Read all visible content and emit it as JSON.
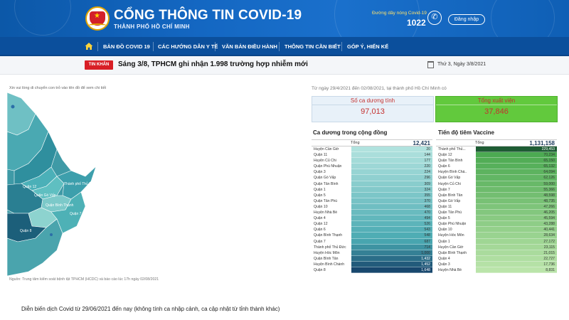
{
  "header": {
    "title": "CỔNG THÔNG TIN COVID-19",
    "subtitle": "THÀNH PHỐ HỒ CHÍ MINH",
    "hotline_label": "Đường dây nóng Covid-19",
    "hotline_number": "1022",
    "login_label": "Đăng nhập"
  },
  "nav": {
    "items": [
      "BẢN ĐỒ COVID 19",
      "CÁC HƯỚNG DẪN Y TẾ",
      "VĂN BẢN ĐIỀU HÀNH",
      "THÔNG TIN CẦN BIẾT",
      "GÓP Ý, HIẾN KẾ"
    ]
  },
  "ticker": {
    "badge": "TIN KHẨN",
    "text": "Sáng 3/8, TPHCM ghi nhận 1.998 trường hợp nhiễm mới",
    "date": "Thứ 3, Ngày 3/8/2021"
  },
  "map": {
    "hint": "Xin vui lòng di chuyển con trỏ vào tên đồ để xem chi tiết",
    "source": "Nguồn: Trung tâm kiểm soát bệnh tật TPHCM (HCDC) và báo cáo lúc 17h ngày 02/08/2021",
    "labels": [
      "Quận 12",
      "Quận Gò Vấp",
      "Thành phố Thủ Đức",
      "Quận Bình Thạnh",
      "Quận 7",
      "Quận 8"
    ]
  },
  "summary": {
    "range": "Từ ngày 29/4/2021 đến 02/08/2021, tại thành phố Hồ Chí Minh có",
    "positive_label": "Số ca dương tính",
    "positive_value": "97,013",
    "discharged_label": "Tổng xuất viện",
    "discharged_value": "37,846"
  },
  "community": {
    "title": "Ca dương trong cộng đồng",
    "total_label": "Tổng",
    "total_value": "12,421",
    "rows": [
      {
        "name": "Huyện Cần Giờ",
        "value": "20"
      },
      {
        "name": "Quận 11",
        "value": "144"
      },
      {
        "name": "Huyện Củ Chi",
        "value": "177"
      },
      {
        "name": "Quận Phú Nhuận",
        "value": "220"
      },
      {
        "name": "Quận 3",
        "value": "224"
      },
      {
        "name": "Quận Gò Vấp",
        "value": "296"
      },
      {
        "name": "Quận Tân Bình",
        "value": "309"
      },
      {
        "name": "Quận 1",
        "value": "324"
      },
      {
        "name": "Quận 5",
        "value": "355"
      },
      {
        "name": "Quận Tân Phú",
        "value": "370"
      },
      {
        "name": "Quận 10",
        "value": "468"
      },
      {
        "name": "Huyện Nhà Bè",
        "value": "470"
      },
      {
        "name": "Quận 4",
        "value": "494"
      },
      {
        "name": "Quận 12",
        "value": "526"
      },
      {
        "name": "Quận 6",
        "value": "543"
      },
      {
        "name": "Quận Bình Thạnh",
        "value": "548"
      },
      {
        "name": "Quận 7",
        "value": "687"
      },
      {
        "name": "Thành phố Thủ Đức",
        "value": "714"
      },
      {
        "name": "Huyện Hóc Môn",
        "value": "1,000"
      },
      {
        "name": "Quận Bình Tân",
        "value": "1,432"
      },
      {
        "name": "Huyện Bình Chánh",
        "value": "1,452"
      },
      {
        "name": "Quận 8",
        "value": "1,648"
      }
    ]
  },
  "vaccine": {
    "title": "Tiến độ tiêm Vaccine",
    "total_label": "Tổng",
    "total_value": "1,131,158",
    "rows": [
      {
        "name": "Thành phố Thủ...",
        "value": "229,453"
      },
      {
        "name": "Quận 12",
        "value": "70,234"
      },
      {
        "name": "Quận Tân Bình",
        "value": "65,150"
      },
      {
        "name": "Quận 6",
        "value": "65,132"
      },
      {
        "name": "Huyện Bình Chá..",
        "value": "64,094"
      },
      {
        "name": "Quận Gò Vấp",
        "value": "62,126"
      },
      {
        "name": "Huyện Củ Chi",
        "value": "59,000"
      },
      {
        "name": "Quận 7",
        "value": "55,366"
      },
      {
        "name": "Quận Bình Tân",
        "value": "48,598"
      },
      {
        "name": "Quận Gò Vấp",
        "value": "48,735"
      },
      {
        "name": "Quận 11",
        "value": "47,266"
      },
      {
        "name": "Quận Tân Phú",
        "value": "46,205"
      },
      {
        "name": "Quận 5",
        "value": "45,594"
      },
      {
        "name": "Quận Phú Nhuận",
        "value": "43,288"
      },
      {
        "name": "Quận 10",
        "value": "40,441"
      },
      {
        "name": "Huyện Hóc Môn",
        "value": "28,634"
      },
      {
        "name": "Quận 1",
        "value": "27,172"
      },
      {
        "name": "Huyện Cần Giờ",
        "value": "23,115"
      },
      {
        "name": "Quận Bình Thạnh",
        "value": "21,015"
      },
      {
        "name": "Quận 4",
        "value": "22,727"
      },
      {
        "name": "Quận 3",
        "value": "17,736"
      },
      {
        "name": "Huyện Nhà Bè",
        "value": "8,831"
      }
    ]
  },
  "bottom": {
    "text": "Diễn biến dịch Covid  từ 29/06/2021 đến nay (không tính ca nhập cảnh, ca cập nhật từ tỉnh thành khác)"
  },
  "colors": {
    "header": "#1467c2",
    "nav": "#0b4f9c",
    "urgent": "#d81f26",
    "positive_text": "#c4312f",
    "discharged_bg": "#62c93d"
  }
}
